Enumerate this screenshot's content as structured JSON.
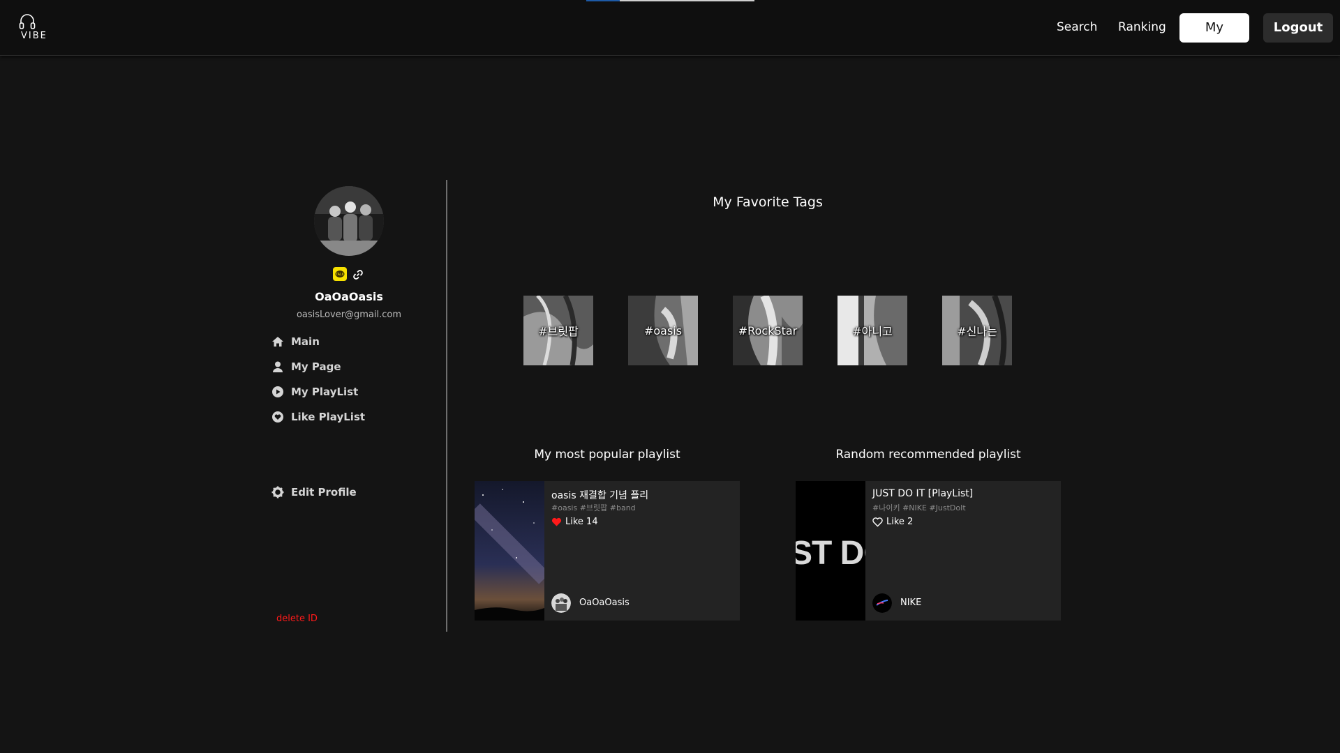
{
  "header": {
    "logo_text": "VIBE",
    "nav": {
      "search": "Search",
      "ranking": "Ranking",
      "my": "My",
      "logout": "Logout"
    },
    "progress": 0.2
  },
  "sidebar": {
    "profile_name": "OaOaOasis",
    "profile_email": "oasisLover@gmail.com",
    "menu": [
      {
        "label": "Main",
        "icon": "home-icon"
      },
      {
        "label": "My Page",
        "icon": "user-icon"
      },
      {
        "label": "My PlayList",
        "icon": "play-circle-icon"
      },
      {
        "label": "Like PlayList",
        "icon": "heart-circle-icon"
      }
    ],
    "edit_profile": "Edit Profile",
    "delete_id": "delete ID"
  },
  "main": {
    "favorite_tags_title": "My Favorite Tags",
    "tags": [
      "#브릿팝",
      "#oasis",
      "#RockStar",
      "#아니고",
      "#신나는"
    ],
    "popular_title": "My most popular playlist",
    "random_title": "Random recommended playlist",
    "popular_card": {
      "title": "oasis 재결합 기념 플리",
      "tags": "#oasis #브릿팝 #band",
      "like": "Like 14",
      "owner": "OaOaOasis",
      "liked": true
    },
    "random_card": {
      "title": "JUST DO IT [PlayList]",
      "tags": "#나이키 #NIKE #JustDoIt",
      "like": "Like 2",
      "owner": "NIKE",
      "liked": false,
      "thumb_text": "ST DO"
    }
  },
  "colors": {
    "background": "#141414",
    "card": "#232323",
    "danger": "#ff1a1a",
    "like": "#ff1a1a",
    "kakao": "#f7e100"
  }
}
